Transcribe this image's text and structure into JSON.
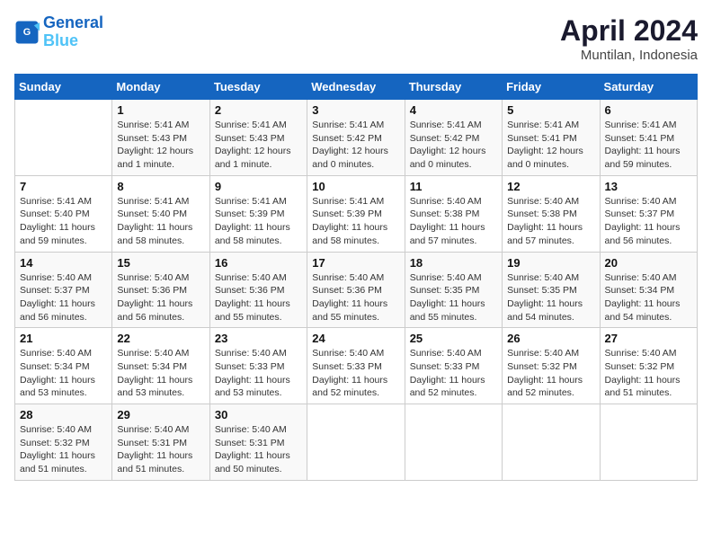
{
  "header": {
    "logo_line1": "General",
    "logo_line2": "Blue",
    "month": "April 2024",
    "location": "Muntilan, Indonesia"
  },
  "weekdays": [
    "Sunday",
    "Monday",
    "Tuesday",
    "Wednesday",
    "Thursday",
    "Friday",
    "Saturday"
  ],
  "weeks": [
    [
      {
        "day": "",
        "info": ""
      },
      {
        "day": "1",
        "info": "Sunrise: 5:41 AM\nSunset: 5:43 PM\nDaylight: 12 hours\nand 1 minute."
      },
      {
        "day": "2",
        "info": "Sunrise: 5:41 AM\nSunset: 5:43 PM\nDaylight: 12 hours\nand 1 minute."
      },
      {
        "day": "3",
        "info": "Sunrise: 5:41 AM\nSunset: 5:42 PM\nDaylight: 12 hours\nand 0 minutes."
      },
      {
        "day": "4",
        "info": "Sunrise: 5:41 AM\nSunset: 5:42 PM\nDaylight: 12 hours\nand 0 minutes."
      },
      {
        "day": "5",
        "info": "Sunrise: 5:41 AM\nSunset: 5:41 PM\nDaylight: 12 hours\nand 0 minutes."
      },
      {
        "day": "6",
        "info": "Sunrise: 5:41 AM\nSunset: 5:41 PM\nDaylight: 11 hours\nand 59 minutes."
      }
    ],
    [
      {
        "day": "7",
        "info": "Sunrise: 5:41 AM\nSunset: 5:40 PM\nDaylight: 11 hours\nand 59 minutes."
      },
      {
        "day": "8",
        "info": "Sunrise: 5:41 AM\nSunset: 5:40 PM\nDaylight: 11 hours\nand 58 minutes."
      },
      {
        "day": "9",
        "info": "Sunrise: 5:41 AM\nSunset: 5:39 PM\nDaylight: 11 hours\nand 58 minutes."
      },
      {
        "day": "10",
        "info": "Sunrise: 5:41 AM\nSunset: 5:39 PM\nDaylight: 11 hours\nand 58 minutes."
      },
      {
        "day": "11",
        "info": "Sunrise: 5:40 AM\nSunset: 5:38 PM\nDaylight: 11 hours\nand 57 minutes."
      },
      {
        "day": "12",
        "info": "Sunrise: 5:40 AM\nSunset: 5:38 PM\nDaylight: 11 hours\nand 57 minutes."
      },
      {
        "day": "13",
        "info": "Sunrise: 5:40 AM\nSunset: 5:37 PM\nDaylight: 11 hours\nand 56 minutes."
      }
    ],
    [
      {
        "day": "14",
        "info": "Sunrise: 5:40 AM\nSunset: 5:37 PM\nDaylight: 11 hours\nand 56 minutes."
      },
      {
        "day": "15",
        "info": "Sunrise: 5:40 AM\nSunset: 5:36 PM\nDaylight: 11 hours\nand 56 minutes."
      },
      {
        "day": "16",
        "info": "Sunrise: 5:40 AM\nSunset: 5:36 PM\nDaylight: 11 hours\nand 55 minutes."
      },
      {
        "day": "17",
        "info": "Sunrise: 5:40 AM\nSunset: 5:36 PM\nDaylight: 11 hours\nand 55 minutes."
      },
      {
        "day": "18",
        "info": "Sunrise: 5:40 AM\nSunset: 5:35 PM\nDaylight: 11 hours\nand 55 minutes."
      },
      {
        "day": "19",
        "info": "Sunrise: 5:40 AM\nSunset: 5:35 PM\nDaylight: 11 hours\nand 54 minutes."
      },
      {
        "day": "20",
        "info": "Sunrise: 5:40 AM\nSunset: 5:34 PM\nDaylight: 11 hours\nand 54 minutes."
      }
    ],
    [
      {
        "day": "21",
        "info": "Sunrise: 5:40 AM\nSunset: 5:34 PM\nDaylight: 11 hours\nand 53 minutes."
      },
      {
        "day": "22",
        "info": "Sunrise: 5:40 AM\nSunset: 5:34 PM\nDaylight: 11 hours\nand 53 minutes."
      },
      {
        "day": "23",
        "info": "Sunrise: 5:40 AM\nSunset: 5:33 PM\nDaylight: 11 hours\nand 53 minutes."
      },
      {
        "day": "24",
        "info": "Sunrise: 5:40 AM\nSunset: 5:33 PM\nDaylight: 11 hours\nand 52 minutes."
      },
      {
        "day": "25",
        "info": "Sunrise: 5:40 AM\nSunset: 5:33 PM\nDaylight: 11 hours\nand 52 minutes."
      },
      {
        "day": "26",
        "info": "Sunrise: 5:40 AM\nSunset: 5:32 PM\nDaylight: 11 hours\nand 52 minutes."
      },
      {
        "day": "27",
        "info": "Sunrise: 5:40 AM\nSunset: 5:32 PM\nDaylight: 11 hours\nand 51 minutes."
      }
    ],
    [
      {
        "day": "28",
        "info": "Sunrise: 5:40 AM\nSunset: 5:32 PM\nDaylight: 11 hours\nand 51 minutes."
      },
      {
        "day": "29",
        "info": "Sunrise: 5:40 AM\nSunset: 5:31 PM\nDaylight: 11 hours\nand 51 minutes."
      },
      {
        "day": "30",
        "info": "Sunrise: 5:40 AM\nSunset: 5:31 PM\nDaylight: 11 hours\nand 50 minutes."
      },
      {
        "day": "",
        "info": ""
      },
      {
        "day": "",
        "info": ""
      },
      {
        "day": "",
        "info": ""
      },
      {
        "day": "",
        "info": ""
      }
    ]
  ]
}
